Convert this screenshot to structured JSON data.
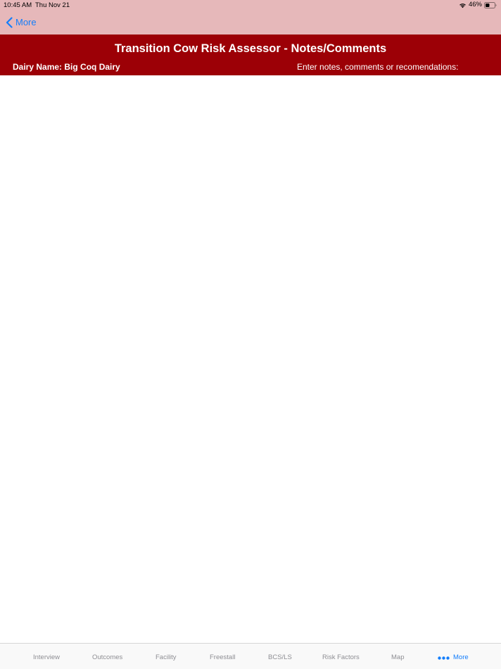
{
  "status_bar": {
    "time": "10:45 AM",
    "date": "Thu Nov 21",
    "battery_percent": "46%",
    "battery_level": 0.46,
    "icons": [
      "wifi-icon",
      "battery-icon"
    ]
  },
  "nav": {
    "back_label": "More",
    "back_icon": "chevron-left-icon"
  },
  "header": {
    "title": "Transition Cow Risk Assessor - Notes/Comments",
    "dairy_name": "Dairy Name: Big Coq Dairy",
    "notes_prompt": "Enter notes, comments or recomendations:"
  },
  "notes": {
    "value": ""
  },
  "tabs": [
    {
      "label": "Interview"
    },
    {
      "label": "Outcomes"
    },
    {
      "label": "Facility"
    },
    {
      "label": "Freestall"
    },
    {
      "label": "BCS/LS"
    },
    {
      "label": "Risk Factors"
    },
    {
      "label": "Map"
    },
    {
      "label": "More",
      "icon": "more-dots-icon",
      "selected": true
    }
  ],
  "colors": {
    "top_bar": "#e6b8ba",
    "header": "#9c0006",
    "accent": "#147efb",
    "tab_inactive": "#8e8e93"
  }
}
